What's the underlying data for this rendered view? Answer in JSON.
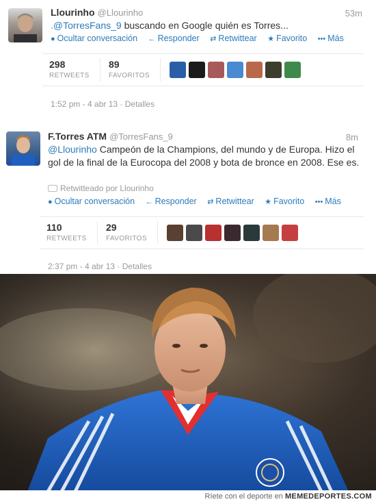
{
  "tweet1": {
    "name": "Llourinho",
    "handle": "@Llourinho",
    "age": "53m",
    "mention": ".@TorresFans_9",
    "text": " buscando en Google quién es Torres...",
    "actions": {
      "hide": "Ocultar conversación",
      "reply": "Responder",
      "retweet": "Retwittear",
      "favorite": "Favorito",
      "more": "Más"
    },
    "retweets_count": "298",
    "retweets_label": "RETWEETS",
    "favorites_count": "89",
    "favorites_label": "FAVORITOS",
    "timestamp": "1:52 pm - 4 abr 13",
    "details": "Detalles"
  },
  "tweet2": {
    "name": "F.Torres ATM",
    "handle": "@TorresFans_9",
    "age": "8m",
    "mention": "@Llourinho",
    "text": " Campeón de la Champions, del mundo y de Europa. Hizo el gol de la final de la Eurocopa del 2008 y bota de bronce en 2008. Ese es.",
    "retweeted_by": "Retwitteado por Llourinho",
    "actions": {
      "hide": "Ocultar conversación",
      "reply": "Responder",
      "retweet": "Retwittear",
      "favorite": "Favorito",
      "more": "Más"
    },
    "retweets_count": "110",
    "retweets_label": "RETWEETS",
    "favorites_count": "29",
    "favorites_label": "FAVORITOS",
    "timestamp": "2:37 pm - 4 abr 13",
    "details": "Detalles"
  },
  "footer": {
    "prefix": "Ríete con el deporte en",
    "brand": "MEMEDEPORTES.COM"
  },
  "colors": {
    "link": "#2b7bb9",
    "muted": "#999999",
    "jersey": "#1f5fbf"
  },
  "icons": [
    "speech-bubble-icon",
    "reply-arrow-icon",
    "retweet-icon",
    "star-icon",
    "more-dots-icon",
    "retweet-small-icon"
  ]
}
